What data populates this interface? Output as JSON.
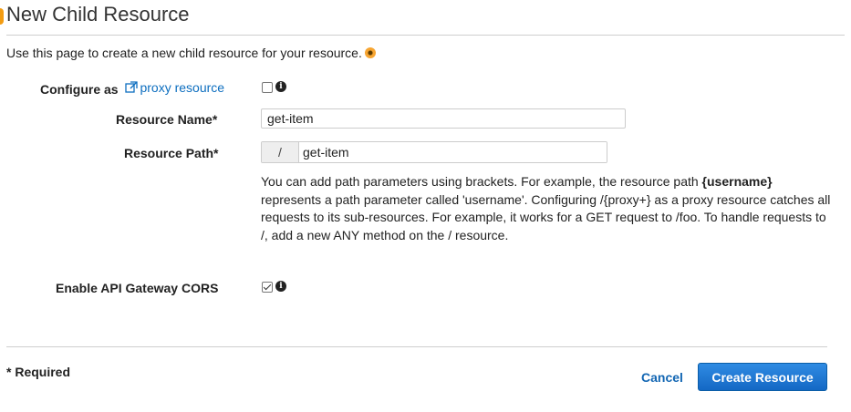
{
  "page": {
    "title": "New Child Resource",
    "intro": "Use this page to create a new child resource for your resource."
  },
  "form": {
    "proxy": {
      "label_prefix": "Configure as",
      "link_text": "proxy resource",
      "checked": false
    },
    "resource_name": {
      "label": "Resource Name*",
      "value": "get-item"
    },
    "resource_path": {
      "label": "Resource Path*",
      "prefix": "/",
      "value": "get-item"
    },
    "help": {
      "part1": "You can add path parameters using brackets. For example, the resource path ",
      "bold": "{username}",
      "part2": " represents a path parameter called 'username'. Configuring /{proxy+} as a proxy resource catches all requests to its sub-resources. For example, it works for a GET request to /foo. To handle requests to /, add a new ANY method on the / resource."
    },
    "cors": {
      "label": "Enable API Gateway CORS",
      "checked": true
    }
  },
  "footer": {
    "required_note": "* Required",
    "cancel_label": "Cancel",
    "create_label": "Create Resource"
  },
  "icons": {
    "info": "info-icon",
    "external_link": "external-link-icon",
    "help": "orange-help-dot-icon"
  },
  "colors": {
    "link": "#0d6ebf",
    "primary_button": "#1e78d2",
    "accent": "#f39c12"
  }
}
